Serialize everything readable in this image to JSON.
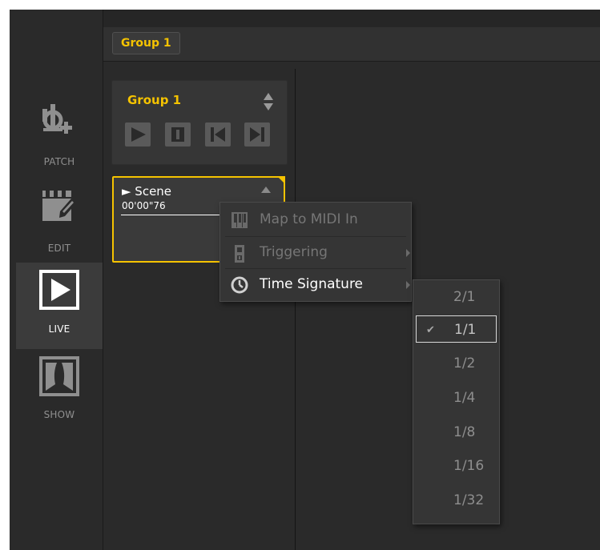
{
  "sidebar": {
    "modes": [
      {
        "label": "PATCH",
        "icon": "patch-fixture-icon"
      },
      {
        "label": "EDIT",
        "icon": "clapperboard-edit-icon"
      },
      {
        "label": "LIVE",
        "icon": "play-live-icon",
        "active": true
      },
      {
        "label": "SHOW",
        "icon": "stage-curtain-icon"
      }
    ]
  },
  "tabs": {
    "active_tab": "Group 1"
  },
  "group": {
    "title": "Group 1",
    "controls": [
      "play-icon",
      "pause-icon",
      "previous-icon",
      "next-icon"
    ]
  },
  "scene": {
    "name": "► Scene",
    "time": "00'00\"76"
  },
  "context_menu": {
    "items": [
      {
        "label": "Map to MIDI In",
        "icon": "midi-keyboard-icon",
        "enabled": false
      },
      {
        "label": "Triggering",
        "icon": "trigger-icon",
        "enabled": false,
        "submenu": true
      },
      {
        "label": "Time Signature",
        "icon": "clock-icon",
        "enabled": true,
        "submenu": true
      }
    ]
  },
  "time_signature_menu": {
    "options": [
      "2/1",
      "1/1",
      "1/2",
      "1/4",
      "1/8",
      "1/16",
      "1/32"
    ],
    "selected": "1/1",
    "check_mark": "✔"
  },
  "colors": {
    "accent": "#f5c300",
    "background": "#262626",
    "panel": "#2a2a2a"
  }
}
